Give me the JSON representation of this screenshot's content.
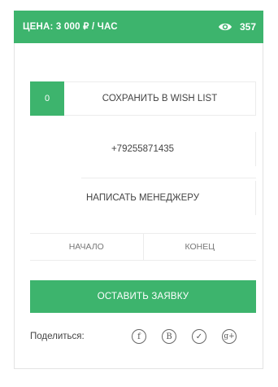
{
  "header": {
    "price": "ЦЕНА: 3 000 ₽ / ЧАС",
    "views_count": "357",
    "views_icon": "eye-icon"
  },
  "wishlist": {
    "count": "0",
    "label": "СОХРАНИТЬ В WISH LIST"
  },
  "contact": {
    "phone": "+79255871435",
    "write_manager": "НАПИСАТЬ МЕНЕДЖЕРУ"
  },
  "period": {
    "start": "НАЧАЛО",
    "end": "КОНЕЦ"
  },
  "cta": {
    "label": "ОСТАВИТЬ ЗАЯВКУ"
  },
  "share": {
    "label": "Поделиться:",
    "networks": [
      {
        "icon": "facebook-icon",
        "glyph": "f"
      },
      {
        "icon": "vk-icon",
        "glyph": "B"
      },
      {
        "icon": "twitter-icon",
        "glyph": "✓"
      },
      {
        "icon": "google-plus-icon",
        "glyph": "g+"
      }
    ]
  },
  "colors": {
    "accent": "#3db46d",
    "border": "#ececec"
  }
}
